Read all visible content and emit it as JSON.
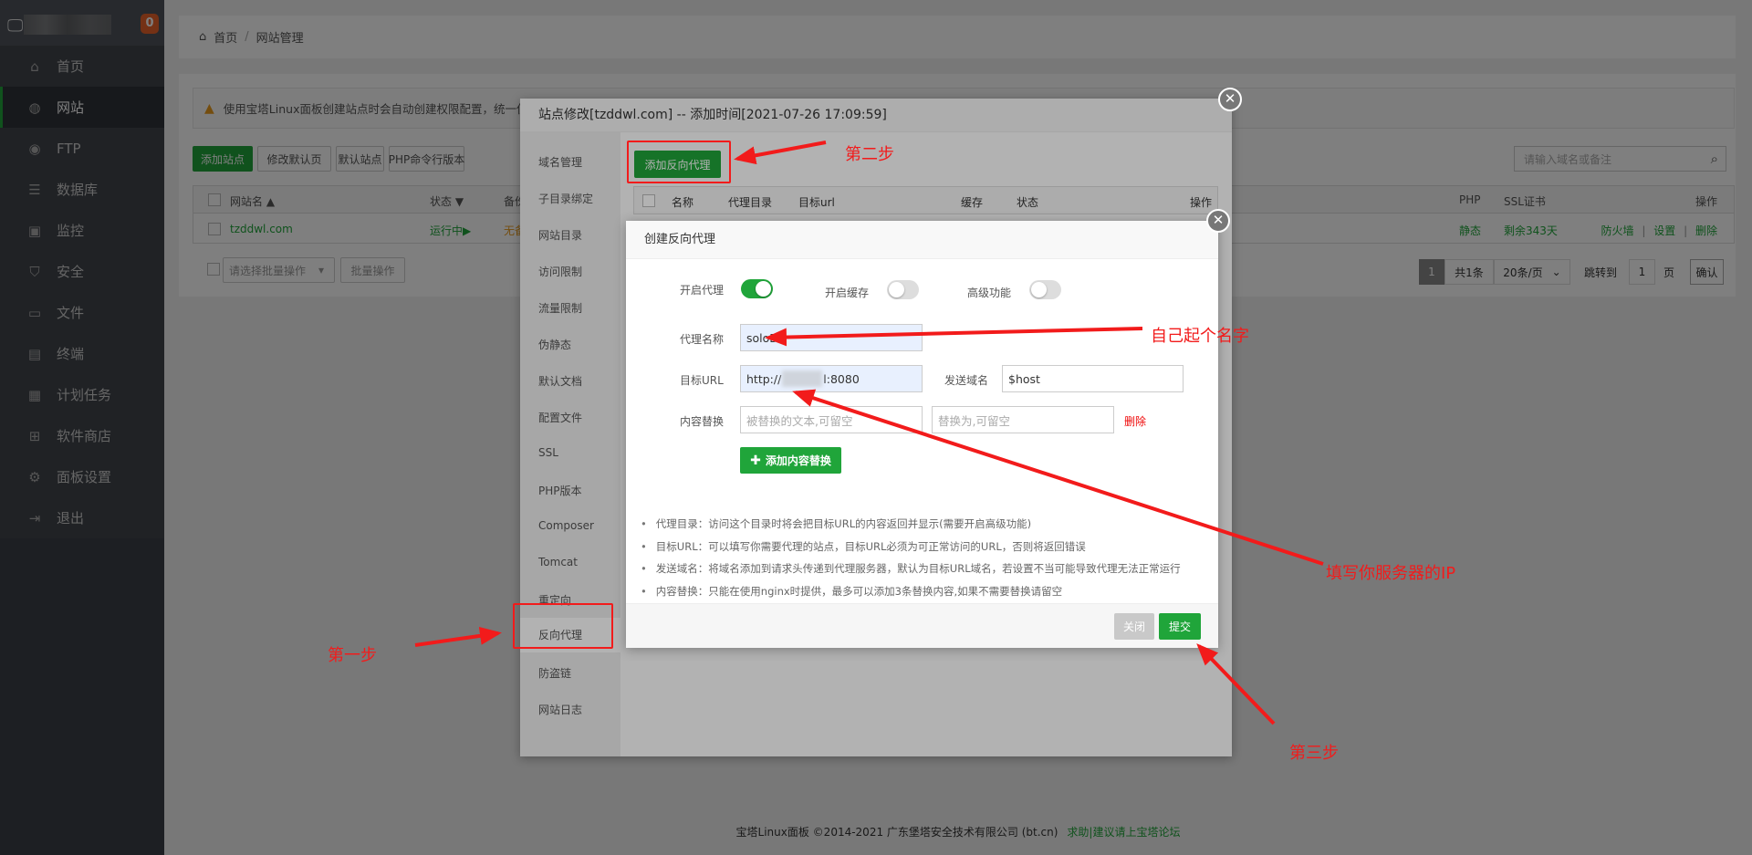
{
  "sidebar": {
    "badge": "0",
    "logo_icon": "monitor-icon",
    "items": [
      {
        "label": "首页",
        "icon": "home-icon",
        "glyph": "⌂"
      },
      {
        "label": "网站",
        "icon": "globe-icon",
        "glyph": "◍",
        "active": true
      },
      {
        "label": "FTP",
        "icon": "ftp-icon",
        "glyph": "◉"
      },
      {
        "label": "数据库",
        "icon": "database-icon",
        "glyph": "☰"
      },
      {
        "label": "监控",
        "icon": "monitor-chart-icon",
        "glyph": "▣"
      },
      {
        "label": "安全",
        "icon": "shield-icon",
        "glyph": "⛉"
      },
      {
        "label": "文件",
        "icon": "folder-icon",
        "glyph": "▭"
      },
      {
        "label": "终端",
        "icon": "terminal-icon",
        "glyph": "▤"
      },
      {
        "label": "计划任务",
        "icon": "calendar-icon",
        "glyph": "▦"
      },
      {
        "label": "软件商店",
        "icon": "apps-icon",
        "glyph": "⊞"
      },
      {
        "label": "面板设置",
        "icon": "gear-icon",
        "glyph": "⚙"
      },
      {
        "label": "退出",
        "icon": "logout-icon",
        "glyph": "⇥"
      }
    ]
  },
  "breadcrumb": {
    "home": "首页",
    "sep": "/",
    "current": "网站管理"
  },
  "main": {
    "warning": "使用宝塔Linux面板创建站点时会自动创建权限配置，统一使用",
    "toolbar": [
      "添加站点",
      "修改默认页",
      "默认站点",
      "PHP命令行版本"
    ],
    "search_placeholder": "请输入域名或备注",
    "headers": {
      "name": "网站名 ▲",
      "status": "状态 ▼",
      "backup": "备份",
      "php": "PHP",
      "ssl": "SSL证书",
      "ops": "操作"
    },
    "row": {
      "name": "tzddwl.com",
      "status": "运行中▶",
      "backup": "无备份",
      "php": "静态",
      "ssl": "剩余343天",
      "ops": [
        "防火墙",
        "设置",
        "删除"
      ],
      "sep": "|"
    },
    "batch_select": "请选择批量操作",
    "batch_button": "批量操作",
    "pagination": {
      "current": "1",
      "total": "共1条",
      "per_page": "20条/页",
      "goto": "跳转到",
      "goto_value": "1",
      "page": "页",
      "confirm": "确认"
    }
  },
  "footer": {
    "copyright": "宝塔Linux面板 ©2014-2021 广东堡塔安全技术有限公司 (bt.cn)",
    "link": "求助|建议请上宝塔论坛"
  },
  "site_dialog": {
    "title": "站点修改[tzddwl.com] -- 添加时间[2021-07-26 17:09:59]",
    "menu": [
      "域名管理",
      "子目录绑定",
      "网站目录",
      "访问限制",
      "流量限制",
      "伪静态",
      "默认文档",
      "配置文件",
      "SSL",
      "PHP版本",
      "Composer",
      "Tomcat",
      "重定向",
      "反向代理",
      "防盗链",
      "网站日志"
    ],
    "active_menu": "反向代理",
    "add_button": "添加反向代理",
    "headers": {
      "name": "名称",
      "dir": "代理目录",
      "url": "目标url",
      "cache": "缓存",
      "status": "状态",
      "ops": "操作"
    }
  },
  "proxy_dialog": {
    "title": "创建反向代理",
    "toggles": [
      {
        "label": "开启代理",
        "on": true
      },
      {
        "label": "开启缓存",
        "on": false
      },
      {
        "label": "高级功能",
        "on": false
      }
    ],
    "name_label": "代理名称",
    "name_value": "soloDl",
    "url_label": "目标URL",
    "url_prefix": "http://",
    "url_suffix": "l:8080",
    "host_label": "发送域名",
    "host_value": "$host",
    "replace_label": "内容替换",
    "replace_from_placeholder": "被替换的文本,可留空",
    "replace_to_placeholder": "替换为,可留空",
    "delete": "删除",
    "add_replace": "添加内容替换",
    "notes": [
      "代理目录：访问这个目录时将会把目标URL的内容返回并显示(需要开启高级功能)",
      "目标URL：可以填写你需要代理的站点，目标URL必须为可正常访问的URL，否则将返回错误",
      "发送域名：将域名添加到请求头传递到代理服务器，默认为目标URL域名，若设置不当可能导致代理无法正常运行",
      "内容替换：只能在使用nginx时提供，最多可以添加3条替换内容,如果不需要替换请留空"
    ],
    "close": "关闭",
    "submit": "提交"
  },
  "annotations": {
    "step1": "第一步",
    "step2": "第二步",
    "step3": "第三步",
    "name_hint": "自己起个名字",
    "ip_hint": "填写你服务器的IP",
    "color": "#f21b1b"
  }
}
